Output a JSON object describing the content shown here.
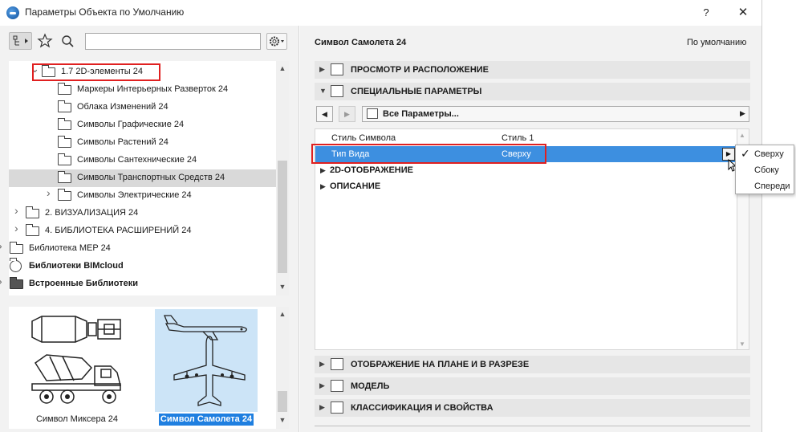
{
  "window": {
    "title": "Параметры Объекта по Умолчанию",
    "help": "?",
    "close": "✕"
  },
  "library": {
    "search_value": "",
    "tree": [
      {
        "label": "1.7 2D-элементы 24",
        "depth": 2,
        "expanded": true,
        "bold": false
      },
      {
        "label": "Маркеры Интерьерных Разверток 24",
        "depth": 3
      },
      {
        "label": "Облака Изменений 24",
        "depth": 3
      },
      {
        "label": "Символы Графические 24",
        "depth": 3
      },
      {
        "label": "Символы Растений 24",
        "depth": 3
      },
      {
        "label": "Символы Сантехнические 24",
        "depth": 3
      },
      {
        "label": "Символы Транспортных Средств 24",
        "depth": 3,
        "selected": true
      },
      {
        "label": "Символы Электрические 24",
        "depth": 3,
        "collapsed": true
      },
      {
        "label": "2. ВИЗУАЛИЗАЦИЯ 24",
        "depth": 1,
        "collapsed": true
      },
      {
        "label": "4. БИБЛИОТЕКА РАСШИРЕНИЙ 24",
        "depth": 1,
        "collapsed": true
      },
      {
        "label": "Библиотека MEP 24",
        "depth": 0,
        "collapsed": true
      },
      {
        "label": "Библиотеки BIMcloud",
        "depth": 0,
        "bold": true
      },
      {
        "label": "Встроенные Библиотеки",
        "depth": 0,
        "collapsed": true,
        "bold": true
      }
    ],
    "previews": {
      "mixer_label": "Символ Миксера 24",
      "plane_label": "Символ Самолета 24"
    }
  },
  "settings": {
    "object_name": "Символ Самолета 24",
    "default_label": "По умолчанию",
    "sections_top": [
      {
        "title": "ПРОСМОТР И РАСПОЛОЖЕНИЕ",
        "expanded": false
      },
      {
        "title": "СПЕЦИАЛЬНЫЕ ПАРАМЕТРЫ",
        "expanded": true
      }
    ],
    "param_dropdown": "Все Параметры...",
    "params": [
      {
        "name": "Стиль Символа",
        "value": "Стиль 1"
      },
      {
        "name": "Тип Вида",
        "value": "Сверху",
        "selected": true
      }
    ],
    "groups": [
      "2D-ОТОБРАЖЕНИЕ",
      "ОПИСАНИЕ"
    ],
    "sections_bottom": [
      {
        "title": "ОТОБРАЖЕНИЕ НА ПЛАНЕ И В РАЗРЕЗЕ"
      },
      {
        "title": "МОДЕЛЬ"
      },
      {
        "title": "КЛАССИФИКАЦИЯ И СВОЙСТВА"
      }
    ],
    "view_popup": {
      "options": [
        "Сверху",
        "Сбоку",
        "Спереди"
      ],
      "checked": "Сверху"
    }
  },
  "colors": {
    "selection_blue": "#3d8fe0",
    "highlight_red": "#e02020",
    "preview_selected_bg": "#cce4f7"
  }
}
